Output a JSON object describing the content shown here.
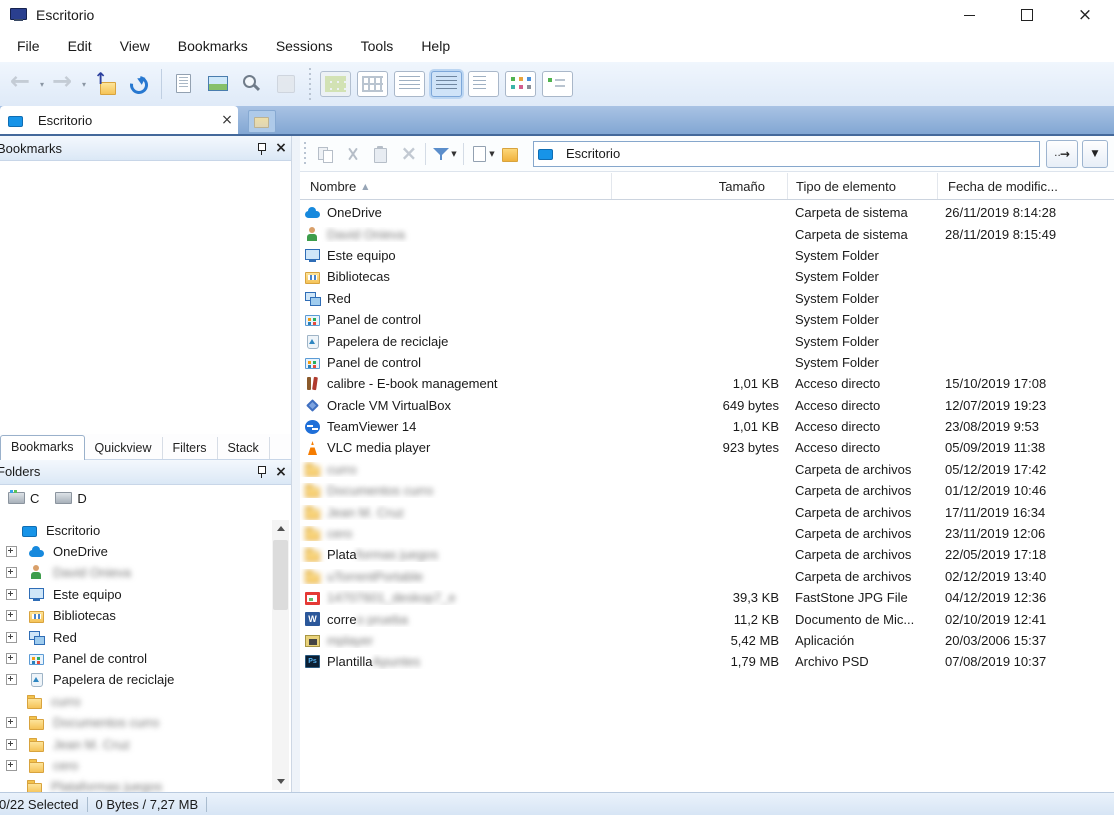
{
  "title_bar": {
    "title": "Escritorio"
  },
  "menu_bar": {
    "items": [
      "File",
      "Edit",
      "View",
      "Bookmarks",
      "Sessions",
      "Tools",
      "Help"
    ]
  },
  "toolbar": {
    "buttons": [
      {
        "icon": "back",
        "disabled": true,
        "dropdown": true
      },
      {
        "icon": "forward",
        "disabled": true,
        "dropdown": true
      },
      {
        "icon": "up"
      },
      {
        "icon": "refresh"
      },
      {
        "sep": true
      },
      {
        "icon": "new-doc"
      },
      {
        "icon": "image-view"
      },
      {
        "icon": "search"
      },
      {
        "icon": "unknown",
        "disabled": true
      },
      {
        "dotsep": true
      }
    ],
    "view_buttons": [
      {
        "name": "view-thumbnails-large",
        "style": 1,
        "disabled": true
      },
      {
        "name": "view-small-icons",
        "style": 2
      },
      {
        "name": "view-columns",
        "style": 3
      },
      {
        "name": "view-details",
        "style": 4,
        "selected": true
      },
      {
        "name": "view-list",
        "style": 5
      },
      {
        "name": "view-thumbnails",
        "style": 6
      },
      {
        "name": "view-tiles",
        "style": 7
      }
    ]
  },
  "tab_bar": {
    "active_tab": "Escritorio"
  },
  "left_panel": {
    "bookmarks_header": "Bookmarks",
    "panel_tabs": [
      {
        "label": "Bookmarks",
        "active": true
      },
      {
        "label": "Quickview"
      },
      {
        "label": "Filters"
      },
      {
        "label": "Stack"
      }
    ],
    "folders_header": "Folders",
    "drives": [
      {
        "label": "C",
        "system": true
      },
      {
        "label": "D"
      }
    ],
    "tree": [
      {
        "label": "Escritorio",
        "icon": "desktop",
        "root": true
      },
      {
        "label": "OneDrive",
        "icon": "cloud",
        "expander": true
      },
      {
        "blur": "David Onieva",
        "icon": "user",
        "expander": true
      },
      {
        "label": "Este equipo",
        "icon": "computer",
        "expander": true
      },
      {
        "label": "Bibliotecas",
        "icon": "library",
        "expander": true
      },
      {
        "label": "Red",
        "icon": "network",
        "expander": true
      },
      {
        "label": "Panel de control",
        "icon": "controlpanel",
        "expander": true
      },
      {
        "label": "Papelera de reciclaje",
        "icon": "recycle",
        "expander": true
      },
      {
        "blur": "curro",
        "icon": "folder"
      },
      {
        "blur": "Documentos curro",
        "icon": "folder",
        "expander": true
      },
      {
        "blur": "Jean M. Cruz",
        "icon": "folder",
        "expander": true
      },
      {
        "blur": "cero",
        "icon": "folder",
        "expander": true
      },
      {
        "blur": "Plataformas juegos",
        "icon": "folder"
      }
    ]
  },
  "command_bar": {
    "buttons": [
      {
        "icon": "copy",
        "disabled": true
      },
      {
        "icon": "cut",
        "disabled": true
      },
      {
        "icon": "paste",
        "disabled": true
      },
      {
        "icon": "delete",
        "disabled": true
      },
      {
        "sep": true
      },
      {
        "icon": "filter",
        "dropdown": true
      },
      {
        "sep": true
      },
      {
        "icon": "new-folder",
        "dropdown": true
      },
      {
        "icon": "goto-folder"
      }
    ]
  },
  "file_panel": {
    "address": {
      "value": "Escritorio"
    },
    "columns": [
      {
        "label": "Nombre",
        "sort": "asc"
      },
      {
        "label": "Tamaño"
      },
      {
        "label": "Tipo de elemento"
      },
      {
        "label": "Fecha de modific..."
      }
    ],
    "rows": [
      {
        "name": "OneDrive",
        "icon": "cloud",
        "size": "",
        "type": "Carpeta de sistema",
        "date": "26/11/2019 8:14:28"
      },
      {
        "name": "",
        "blur": "David Onieva",
        "icon": "user",
        "size": "",
        "type": "Carpeta de sistema",
        "date": "28/11/2019 8:15:49"
      },
      {
        "name": "Este equipo",
        "icon": "computer",
        "size": "",
        "type": "System Folder",
        "date": ""
      },
      {
        "name": "Bibliotecas",
        "icon": "library",
        "size": "",
        "type": "System Folder",
        "date": ""
      },
      {
        "name": "Red",
        "icon": "network",
        "size": "",
        "type": "System Folder",
        "date": ""
      },
      {
        "name": "Panel de control",
        "icon": "controlpanel",
        "size": "",
        "type": "System Folder",
        "date": ""
      },
      {
        "name": "Papelera de reciclaje",
        "icon": "recycle",
        "size": "",
        "type": "System Folder",
        "date": ""
      },
      {
        "name": "Panel de control",
        "icon": "controlpanel",
        "size": "",
        "type": "System Folder",
        "date": ""
      },
      {
        "name": "calibre - E-book management",
        "icon": "calibre",
        "size": "1,01 KB",
        "type": "Acceso directo",
        "date": "15/10/2019 17:08"
      },
      {
        "name": "Oracle VM VirtualBox",
        "icon": "vbox",
        "size": "649 bytes",
        "type": "Acceso directo",
        "date": "12/07/2019 19:23"
      },
      {
        "name": "TeamViewer 14",
        "icon": "teamviewer",
        "size": "1,01 KB",
        "type": "Acceso directo",
        "date": "23/08/2019 9:53"
      },
      {
        "name": "VLC media player",
        "icon": "vlc",
        "size": "923 bytes",
        "type": "Acceso directo",
        "date": "05/09/2019 11:38"
      },
      {
        "name": "",
        "blur": "curro",
        "icon": "folder",
        "size": "",
        "type": "Carpeta de archivos",
        "date": "05/12/2019 17:42"
      },
      {
        "name": "",
        "blur": "Documentos curro",
        "icon": "folder",
        "size": "",
        "type": "Carpeta de archivos",
        "date": "01/12/2019 10:46"
      },
      {
        "name": "",
        "blur": "Jean M. Cruz",
        "icon": "folder",
        "size": "",
        "type": "Carpeta de archivos",
        "date": "17/11/2019 16:34"
      },
      {
        "name": "",
        "blur": "cero",
        "icon": "folder",
        "size": "",
        "type": "Carpeta de archivos",
        "date": "23/11/2019 12:06"
      },
      {
        "name": "Plata",
        "blur": "formas juegos",
        "icon": "folder",
        "size": "",
        "type": "Carpeta de archivos",
        "date": "22/05/2019 17:18"
      },
      {
        "name": "",
        "blur": "uTorrentPortable",
        "icon": "folder",
        "size": "",
        "type": "Carpeta de archivos",
        "date": "02/12/2019 13:40"
      },
      {
        "name": "",
        "blur": "14707601_deskop7_e",
        "icon": "jpg",
        "size": "39,3 KB",
        "type": "FastStone JPG File",
        "date": "04/12/2019 12:36"
      },
      {
        "name": "corre",
        "blur": "o prueba",
        "icon": "word",
        "size": "11,2 KB",
        "type": "Documento de Mic...",
        "date": "02/10/2019 12:41"
      },
      {
        "name": "",
        "blur": "mplayer",
        "icon": "app",
        "size": "5,42 MB",
        "type": "Aplicación",
        "date": "20/03/2006 15:37"
      },
      {
        "name": "Plantilla ",
        "blur": "Apuntes",
        "icon": "psd",
        "size": "1,79 MB",
        "type": "Archivo PSD",
        "date": "07/08/2019 10:37"
      }
    ]
  },
  "status_bar": {
    "selection": "0/22 Selected",
    "size_info": "0 Bytes / 7,27 MB"
  }
}
